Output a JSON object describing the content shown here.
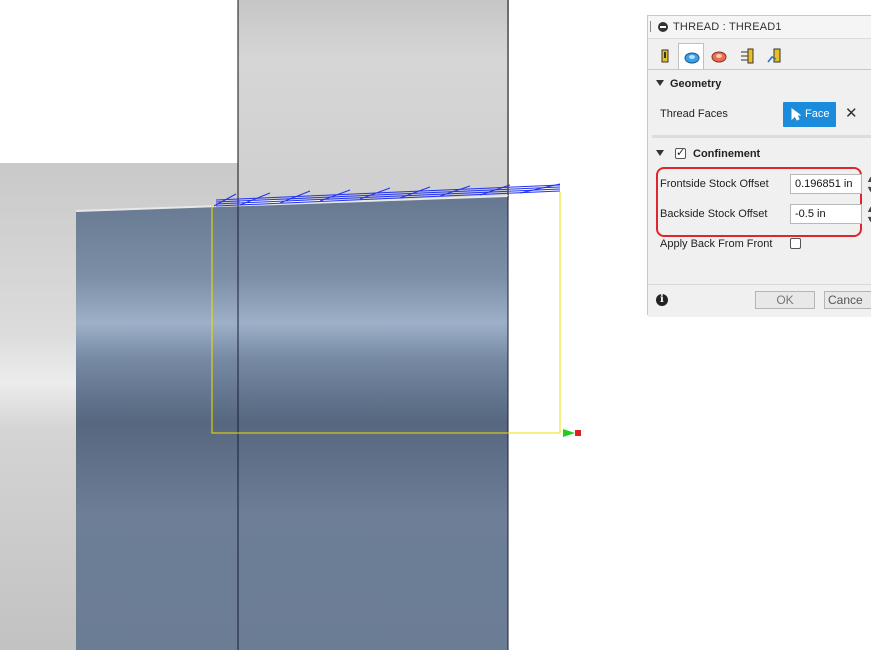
{
  "dialog": {
    "title": "THREAD : THREAD1",
    "tabs": [
      {
        "icon": "tool-icon",
        "active": false
      },
      {
        "icon": "geometry-icon",
        "active": true
      },
      {
        "icon": "heights-icon",
        "active": false
      },
      {
        "icon": "passes-icon",
        "active": false
      },
      {
        "icon": "linking-icon",
        "active": false
      }
    ],
    "geometry": {
      "header": "Geometry",
      "thread_faces_label": "Thread Faces",
      "face_button_label": "Face",
      "accent_color": "#1a8cdb"
    },
    "confinement": {
      "header": "Confinement",
      "checked": true,
      "frontside_label": "Frontside Stock Offset",
      "frontside_value": "0.196851 in",
      "backside_label": "Backside Stock Offset",
      "backside_value": "-0.5 in",
      "apply_back_label": "Apply Back From Front",
      "apply_back_checked": false,
      "highlight_color": "#e0262b"
    },
    "footer": {
      "ok_label": "OK",
      "cancel_label": "Cance"
    }
  }
}
